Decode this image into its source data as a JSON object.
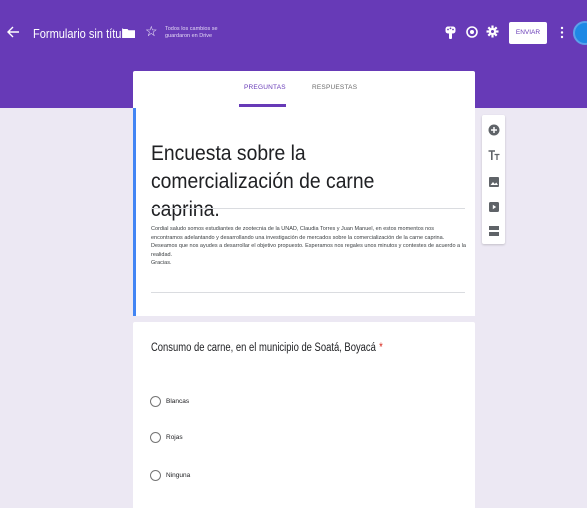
{
  "header": {
    "title": "Formulario sin título",
    "save_status": "Todos los cambios se guardaron en Drive",
    "send_label": "ENVIAR",
    "icons": [
      "arrow-back-icon",
      "folder-icon",
      "star-icon",
      "palette-icon",
      "eye-icon",
      "gear-icon",
      "more-vert-icon"
    ],
    "colors": {
      "theme": "#673ab7",
      "accent_bar": "#4285f4",
      "background": "#ece8f3",
      "avatar": "#1e88e5"
    }
  },
  "tabs": [
    {
      "label": "PREGUNTAS",
      "active": true
    },
    {
      "label": "RESPUESTAS",
      "active": false
    }
  ],
  "form": {
    "title": "Encuesta sobre la comercialización de carne caprina.",
    "description": "Cordial saludo somos estudiantes de zootecnia de la UNAD, Claudia Torres y Juan Manuel, en estos momentos nos encontramos adelantando y desarrollando una investigación de mercados sobre la comercialización de la carne caprina. Deseamos que nos ayudes a desarrollar el objetivo propuesto. Esperamos nos regales unos minutos y contestes de acuerdo a la realidad.\nGracias."
  },
  "question": {
    "title": "Consumo de carne, en el municipio de Soatá, Boyacá",
    "required_marker": "*",
    "options": [
      "Blancas",
      "Rojas",
      "Ninguna"
    ]
  },
  "side_toolbar": {
    "tools": [
      "add-question-icon",
      "add-title-icon",
      "add-image-icon",
      "add-video-icon",
      "add-section-icon"
    ]
  }
}
